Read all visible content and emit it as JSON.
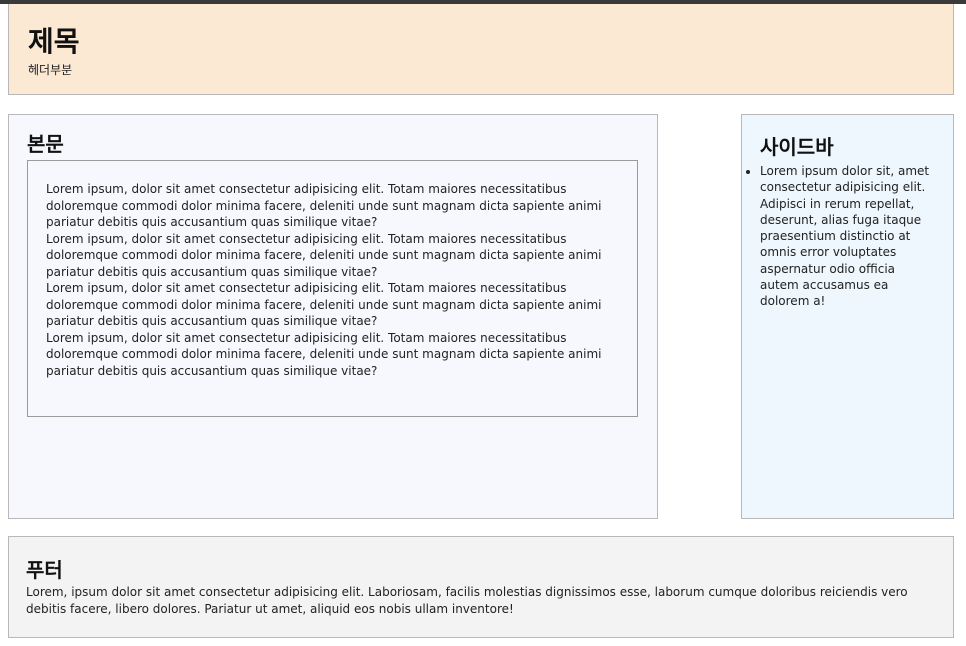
{
  "header": {
    "title": "제목",
    "subtitle": "헤더부분"
  },
  "main": {
    "title": "본문",
    "paragraphs": [
      "Lorem ipsum, dolor sit amet consectetur adipisicing elit. Totam maiores necessitatibus doloremque commodi dolor minima facere, deleniti unde sunt magnam dicta sapiente animi pariatur debitis quis accusantium quas similique vitae?",
      "Lorem ipsum, dolor sit amet consectetur adipisicing elit. Totam maiores necessitatibus doloremque commodi dolor minima facere, deleniti unde sunt magnam dicta sapiente animi pariatur debitis quis accusantium quas similique vitae?",
      "Lorem ipsum, dolor sit amet consectetur adipisicing elit. Totam maiores necessitatibus doloremque commodi dolor minima facere, deleniti unde sunt magnam dicta sapiente animi pariatur debitis quis accusantium quas similique vitae?",
      "Lorem ipsum, dolor sit amet consectetur adipisicing elit. Totam maiores necessitatibus doloremque commodi dolor minima facere, deleniti unde sunt magnam dicta sapiente animi pariatur debitis quis accusantium quas similique vitae?"
    ]
  },
  "sidebar": {
    "title": "사이드바",
    "items": [
      "Lorem ipsum dolor sit, amet consectetur adipisicing elit. Adipisci in rerum repellat, deserunt, alias fuga itaque praesentium distinctio at omnis error voluptates aspernatur odio officia autem accusamus ea dolorem a!"
    ]
  },
  "footer": {
    "title": "푸터",
    "text": "Lorem, ipsum dolor sit amet consectetur adipisicing elit. Laboriosam, facilis molestias dignissimos esse, laborum cumque doloribus reiciendis vero debitis facere, libero dolores. Pariatur ut amet, aliquid eos nobis ullam inventore!"
  },
  "colors": {
    "header_bg": "#fbe9d3",
    "main_bg": "#f7f8fd",
    "sidebar_bg": "#eef7fd",
    "footer_bg": "#f3f3f3",
    "border": "#b8b8b8"
  }
}
